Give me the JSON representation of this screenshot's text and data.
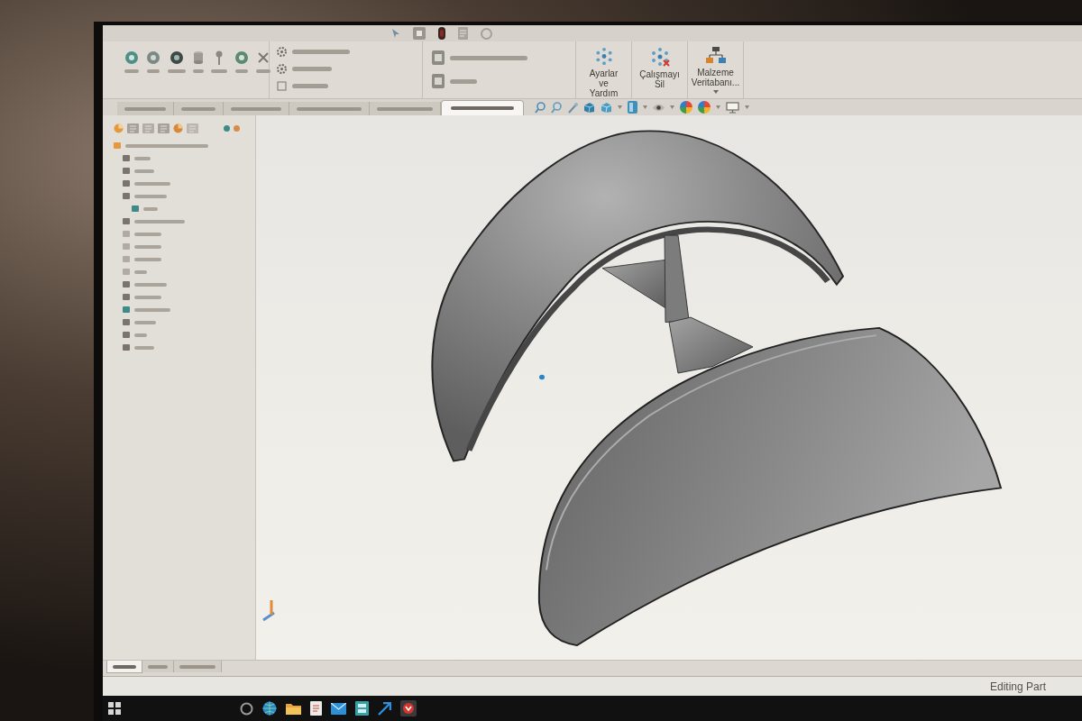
{
  "command_tabs": [
    {
      "selected": false
    },
    {
      "selected": false
    },
    {
      "selected": false
    },
    {
      "selected": false
    },
    {
      "selected": false
    },
    {
      "selected": true
    }
  ],
  "ribbon": {
    "commands": [
      {
        "label": "Ayarlar ve Yardım",
        "kind": "settings",
        "dropdown": false
      },
      {
        "label": "Çalışmayı Sil",
        "kind": "delete",
        "dropdown": false
      },
      {
        "label": "Malzeme Veritabanı...",
        "kind": "database",
        "dropdown": true
      }
    ]
  },
  "bottom_tabs": [
    {
      "selected": true
    },
    {
      "selected": false
    },
    {
      "selected": false
    }
  ],
  "status_bar": {
    "text": "Editing Part"
  }
}
